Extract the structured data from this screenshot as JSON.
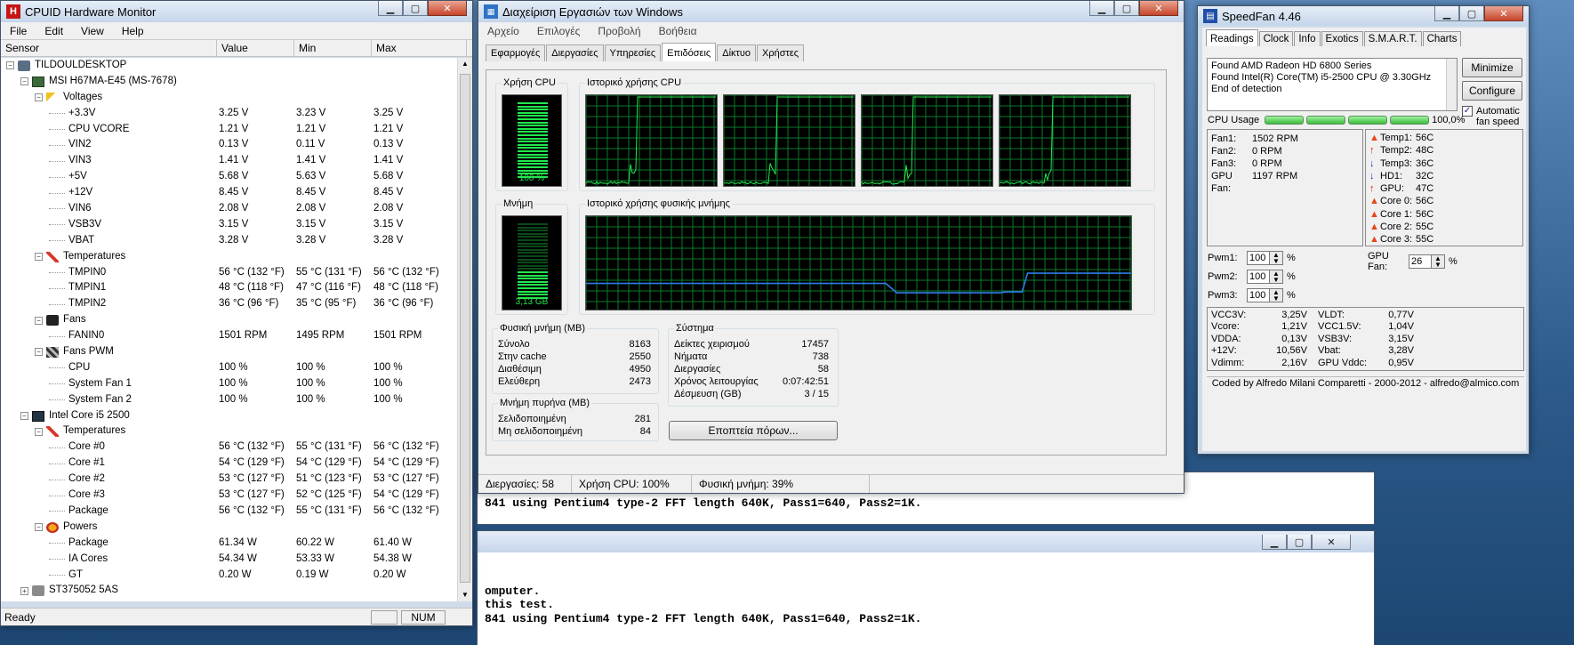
{
  "console": {
    "line_top": "841 using Pentium4 type-2 FFT length 640K, Pass1=640, Pass2=1K.",
    "line1": "omputer.",
    "line2": "this test.",
    "line3": "841 using Pentium4 type-2 FFT length 640K, Pass1=640, Pass2=1K."
  },
  "hwmonitor": {
    "title": "CPUID Hardware Monitor",
    "menu": [
      "File",
      "Edit",
      "View",
      "Help"
    ],
    "columns": [
      "Sensor",
      "Value",
      "Min",
      "Max"
    ],
    "status": "Ready",
    "status_num": "NUM",
    "rows": [
      {
        "level": 0,
        "toggle": "-",
        "icon": "computer-icon",
        "label": "TILDOULDESKTOP",
        "v": "",
        "mn": "",
        "mx": ""
      },
      {
        "level": 1,
        "toggle": "-",
        "icon": "motherboard-icon",
        "label": "MSI H67MA-E45 (MS-7678)",
        "v": "",
        "mn": "",
        "mx": ""
      },
      {
        "level": 2,
        "toggle": "-",
        "icon": "voltage-icon",
        "label": "Voltages",
        "v": "",
        "mn": "",
        "mx": ""
      },
      {
        "level": 3,
        "label": "+3.3V",
        "v": "3.25 V",
        "mn": "3.23 V",
        "mx": "3.25 V"
      },
      {
        "level": 3,
        "label": "CPU VCORE",
        "v": "1.21 V",
        "mn": "1.21 V",
        "mx": "1.21 V"
      },
      {
        "level": 3,
        "label": "VIN2",
        "v": "0.13 V",
        "mn": "0.11 V",
        "mx": "0.13 V"
      },
      {
        "level": 3,
        "label": "VIN3",
        "v": "1.41 V",
        "mn": "1.41 V",
        "mx": "1.41 V"
      },
      {
        "level": 3,
        "label": "+5V",
        "v": "5.68 V",
        "mn": "5.63 V",
        "mx": "5.68 V"
      },
      {
        "level": 3,
        "label": "+12V",
        "v": "8.45 V",
        "mn": "8.45 V",
        "mx": "8.45 V"
      },
      {
        "level": 3,
        "label": "VIN6",
        "v": "2.08 V",
        "mn": "2.08 V",
        "mx": "2.08 V"
      },
      {
        "level": 3,
        "label": "VSB3V",
        "v": "3.15 V",
        "mn": "3.15 V",
        "mx": "3.15 V"
      },
      {
        "level": 3,
        "label": "VBAT",
        "v": "3.28 V",
        "mn": "3.28 V",
        "mx": "3.28 V"
      },
      {
        "level": 2,
        "toggle": "-",
        "icon": "thermometer-icon",
        "label": "Temperatures",
        "v": "",
        "mn": "",
        "mx": ""
      },
      {
        "level": 3,
        "label": "TMPIN0",
        "v": "56 °C  (132 °F)",
        "mn": "55 °C  (131 °F)",
        "mx": "56 °C  (132 °F)"
      },
      {
        "level": 3,
        "label": "TMPIN1",
        "v": "48 °C  (118 °F)",
        "mn": "47 °C  (116 °F)",
        "mx": "48 °C  (118 °F)"
      },
      {
        "level": 3,
        "label": "TMPIN2",
        "v": "36 °C  (96 °F)",
        "mn": "35 °C  (95 °F)",
        "mx": "36 °C  (96 °F)"
      },
      {
        "level": 2,
        "toggle": "-",
        "icon": "fan-icon",
        "label": "Fans",
        "v": "",
        "mn": "",
        "mx": ""
      },
      {
        "level": 3,
        "label": "FANIN0",
        "v": "1501 RPM",
        "mn": "1495 RPM",
        "mx": "1501 RPM"
      },
      {
        "level": 2,
        "toggle": "-",
        "icon": "fan-pwm-icon",
        "label": "Fans PWM",
        "v": "",
        "mn": "",
        "mx": ""
      },
      {
        "level": 3,
        "label": "CPU",
        "v": "100 %",
        "mn": "100 %",
        "mx": "100 %"
      },
      {
        "level": 3,
        "label": "System Fan 1",
        "v": "100 %",
        "mn": "100 %",
        "mx": "100 %"
      },
      {
        "level": 3,
        "label": "System Fan 2",
        "v": "100 %",
        "mn": "100 %",
        "mx": "100 %"
      },
      {
        "level": 1,
        "toggle": "-",
        "icon": "cpu-icon",
        "label": "Intel Core i5 2500",
        "v": "",
        "mn": "",
        "mx": ""
      },
      {
        "level": 2,
        "toggle": "-",
        "icon": "thermometer-icon",
        "label": "Temperatures",
        "v": "",
        "mn": "",
        "mx": ""
      },
      {
        "level": 3,
        "label": "Core #0",
        "v": "56 °C  (132 °F)",
        "mn": "55 °C  (131 °F)",
        "mx": "56 °C  (132 °F)"
      },
      {
        "level": 3,
        "label": "Core #1",
        "v": "54 °C  (129 °F)",
        "mn": "54 °C  (129 °F)",
        "mx": "54 °C  (129 °F)"
      },
      {
        "level": 3,
        "label": "Core #2",
        "v": "53 °C  (127 °F)",
        "mn": "51 °C  (123 °F)",
        "mx": "53 °C  (127 °F)"
      },
      {
        "level": 3,
        "label": "Core #3",
        "v": "53 °C  (127 °F)",
        "mn": "52 °C  (125 °F)",
        "mx": "54 °C  (129 °F)"
      },
      {
        "level": 3,
        "label": "Package",
        "v": "56 °C  (132 °F)",
        "mn": "55 °C  (131 °F)",
        "mx": "56 °C  (132 °F)"
      },
      {
        "level": 2,
        "toggle": "-",
        "icon": "power-icon",
        "label": "Powers",
        "v": "",
        "mn": "",
        "mx": ""
      },
      {
        "level": 3,
        "label": "Package",
        "v": "61.34 W",
        "mn": "60.22 W",
        "mx": "61.40 W"
      },
      {
        "level": 3,
        "label": "IA Cores",
        "v": "54.34 W",
        "mn": "53.33 W",
        "mx": "54.38 W"
      },
      {
        "level": 3,
        "label": "GT",
        "v": "0.20 W",
        "mn": "0.19 W",
        "mx": "0.20 W"
      },
      {
        "level": 1,
        "toggle": "+",
        "icon": "hard-disk-icon",
        "label": "ST375052 5AS",
        "v": "",
        "mn": "",
        "mx": ""
      }
    ]
  },
  "taskmgr": {
    "title": "Διαχείριση Εργασιών των Windows",
    "menu": [
      "Αρχείο",
      "Επιλογές",
      "Προβολή",
      "Βοήθεια"
    ],
    "tabs": [
      "Εφαρμογές",
      "Διεργασίες",
      "Υπηρεσίες",
      "Επιδόσεις",
      "Δίκτυο",
      "Χρήστες"
    ],
    "active_tab": 3,
    "cpu_usage_label": "Χρήση CPU",
    "cpu_usage_value": "100 %",
    "cpu_usage_fraction": 1.0,
    "cpu_history_label": "Ιστορικό χρήσης CPU",
    "memory_label": "Μνήμη",
    "memory_value": "3,13 GB",
    "memory_fraction": 0.39,
    "memory_history_label": "Ιστορικό χρήσης φυσικής μνήμης",
    "physical_memory": {
      "title": "Φυσική μνήμη (MB)",
      "rows": [
        [
          "Σύνολο",
          "8163"
        ],
        [
          "Στην cache",
          "2550"
        ],
        [
          "Διαθέσιμη",
          "4950"
        ],
        [
          "Ελεύθερη",
          "2473"
        ]
      ]
    },
    "kernel_memory": {
      "title": "Μνήμη πυρήνα (MB)",
      "rows": [
        [
          "Σελιδοποιημένη",
          "281"
        ],
        [
          "Μη σελιδοποιημένη",
          "84"
        ]
      ]
    },
    "system": {
      "title": "Σύστημα",
      "rows": [
        [
          "Δείκτες χειρισμού",
          "17457"
        ],
        [
          "Νήματα",
          "738"
        ],
        [
          "Διεργασίες",
          "58"
        ],
        [
          "Χρόνος λειτουργίας",
          "0:07:42:51"
        ],
        [
          "Δέσμευση (GB)",
          "3 / 15"
        ]
      ]
    },
    "resource_monitor_button": "Εποπτεία πόρων...",
    "status": [
      "Διεργασίες: 58",
      "Χρήση CPU: 100%",
      "Φυσική μνήμη: 39%"
    ],
    "chart_colors": {
      "grid": "#0b7a2a",
      "cpu": "#23e64d",
      "memory": "#2d7de8"
    }
  },
  "speedfan": {
    "title": "SpeedFan 4.46",
    "tabs": [
      "Readings",
      "Clock",
      "Info",
      "Exotics",
      "S.M.A.R.T.",
      "Charts"
    ],
    "log": [
      "Found AMD Radeon HD 6800 Series",
      "Found Intel(R) Core(TM) i5-2500 CPU @ 3.30GHz",
      "End of detection"
    ],
    "minimize": "Minimize",
    "configure": "Configure",
    "auto_fan": "Automatic fan speed",
    "cpu_usage_label": "CPU Usage",
    "cpu_usage_value": "100,0%",
    "fans": [
      [
        "Fan1:",
        "1502 RPM"
      ],
      [
        "Fan2:",
        "0 RPM"
      ],
      [
        "Fan3:",
        "0 RPM"
      ],
      [
        "GPU Fan:",
        "1197 RPM"
      ]
    ],
    "temps": [
      {
        "icon": "flame-icon",
        "label": "Temp1:",
        "value": "56C"
      },
      {
        "icon": "arrow-up-icon",
        "label": "Temp2:",
        "value": "48C"
      },
      {
        "icon": "arrow-down-icon",
        "label": "Temp3:",
        "value": "36C"
      },
      {
        "icon": "arrow-down-icon",
        "label": "HD1:",
        "value": "32C"
      },
      {
        "icon": "arrow-up-icon",
        "label": "GPU:",
        "value": "47C"
      },
      {
        "icon": "flame-icon",
        "label": "Core 0:",
        "value": "56C"
      },
      {
        "icon": "flame-icon",
        "label": "Core 1:",
        "value": "56C"
      },
      {
        "icon": "flame-icon",
        "label": "Core 2:",
        "value": "55C"
      },
      {
        "icon": "flame-icon",
        "label": "Core 3:",
        "value": "55C"
      }
    ],
    "pwm": [
      [
        "Pwm1:",
        "100"
      ],
      [
        "Pwm2:",
        "100"
      ],
      [
        "Pwm3:",
        "100"
      ]
    ],
    "gpu_fan_label": "GPU Fan:",
    "gpu_fan_value": "26",
    "percent": "%",
    "volts_left": [
      [
        "VCC3V:",
        "3,25V"
      ],
      [
        "Vcore:",
        "1,21V"
      ],
      [
        "VDDA:",
        "0,13V"
      ],
      [
        "+12V:",
        "10,56V"
      ],
      [
        "Vdimm:",
        "2,16V"
      ]
    ],
    "volts_right": [
      [
        "VLDT:",
        "0,77V"
      ],
      [
        "VCC1.5V:",
        "1,04V"
      ],
      [
        "VSB3V:",
        "3,15V"
      ],
      [
        "Vbat:",
        "3,28V"
      ],
      [
        "GPU Vddc:",
        "0,95V"
      ]
    ],
    "footer": "Coded by Alfredo Milani Comparetti - 2000-2012 - alfredo@almico.com"
  }
}
